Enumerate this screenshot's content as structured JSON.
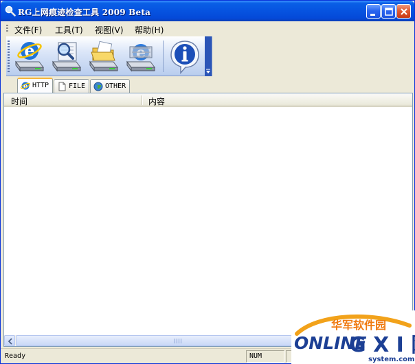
{
  "window": {
    "title": "RG上网痕迹检查工具 2009 Beta",
    "title_icon": "magnifier-icon",
    "controls": [
      "minimize-icon",
      "maximize-icon",
      "close-icon"
    ]
  },
  "menubar": {
    "items": [
      {
        "label": "文件(F)"
      },
      {
        "label": "工具(T)"
      },
      {
        "label": "视图(V)"
      },
      {
        "label": "帮助(H)"
      }
    ]
  },
  "toolbar": {
    "buttons": [
      {
        "icon": "ie-drive-icon"
      },
      {
        "icon": "search-drive-icon"
      },
      {
        "icon": "folder-drive-icon"
      },
      {
        "icon": "network-drive-icon"
      },
      {
        "icon": "info-icon"
      }
    ]
  },
  "tabs": [
    {
      "label": "HTTP",
      "icon": "ie-icon",
      "active": true
    },
    {
      "label": "FILE",
      "icon": "file-icon",
      "active": false
    },
    {
      "label": "OTHER",
      "icon": "globe-icon",
      "active": false
    }
  ],
  "list": {
    "columns": [
      {
        "label": "时间"
      },
      {
        "label": "内容"
      }
    ],
    "rows": []
  },
  "statusbar": {
    "text": "Ready",
    "num_indicator": "NUM"
  },
  "watermark": {
    "line1": "华军软件园",
    "line2": "ONLINE",
    "line3": "G X I 网",
    "line4": "system.com"
  },
  "colors": {
    "titlebar": "#0653e0",
    "tab_accent": "#f6b53a",
    "toolbar": "#b9cdee"
  }
}
